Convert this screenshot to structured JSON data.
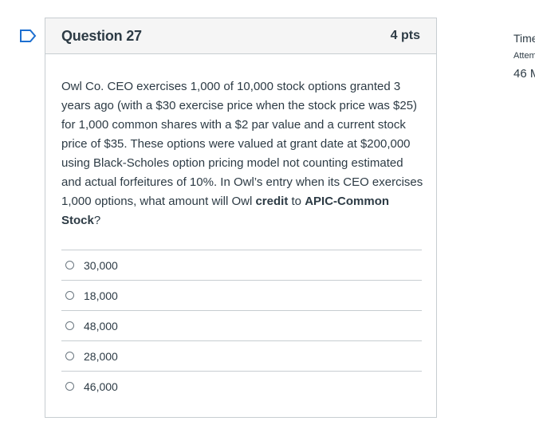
{
  "question": {
    "title": "Question 27",
    "points": "4 pts",
    "text_parts": {
      "intro": "Owl Co. CEO exercises 1,000 of 10,000 stock options granted 3 years ago (with a $30 exercise price when the stock price was $25) for 1,000 common shares with a $2 par value and a current stock price of $35. These options were valued at grant date at $200,000 using Black-Scholes option pricing model not counting estimated and actual forfeitures of 10%.  In Owl’s entry when its CEO exercises 1,000 options, what amount will Owl ",
      "emph1": "credit",
      "mid": " to ",
      "emph2": "APIC-Common Stock",
      "end": "?"
    },
    "answers": [
      "30,000",
      "18,000",
      "48,000",
      "28,000",
      "46,000"
    ]
  },
  "side_panel": {
    "time_label": "Time",
    "attempt_label": "Attempt",
    "value": "46 M"
  }
}
